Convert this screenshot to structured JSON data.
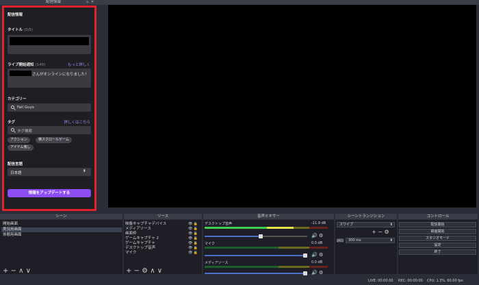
{
  "dock": {
    "title": "配信情報",
    "buttons": "▫ ✕"
  },
  "stream_info": {
    "header": "配信情報",
    "title_label": "タイトル",
    "title_count": "(0/5)",
    "notify_label": "ライブ開始通知",
    "notify_count": "(140)",
    "notify_link": "もっと詳しく",
    "notify_text": "さんがオンラインになりました！",
    "category_label": "カテゴリー",
    "category_value": "Fall Guys",
    "tag_label": "タグ",
    "tag_link": "詳しくはこちら",
    "tag_placeholder": "タグ検索",
    "tags": [
      "アクション",
      "横スクロールゲーム",
      "アイテム蒐し"
    ],
    "language_label": "配信言語",
    "language_value": "日本語",
    "language_arrow": "⬍",
    "update_button": "情報をアップデートする"
  },
  "docks": {
    "scenes": "シーン",
    "sources": "ソース",
    "mixer": "音声ミキサー",
    "transitions": "シーントランジション",
    "controls": "コントロール"
  },
  "scenes": {
    "items": [
      "開始画面",
      "実況用画面",
      "休憩用画面"
    ],
    "toolbar": "+ − ∧ ∨"
  },
  "sources": {
    "items": [
      "映像キャプチャデバイス",
      "メディアソース",
      "画面枠",
      "ゲームキャプチャ 2",
      "ゲームキャプチャ",
      "デスクトップ音声",
      "マイク"
    ],
    "item_icons": "👁 🔒",
    "toolbar": "+ − ⚙ ∧ ∨"
  },
  "mixer": {
    "channels": [
      {
        "name": "デスクトップ音声",
        "db": "-11.9 dB",
        "level": 0.72,
        "volume": 0.55
      },
      {
        "name": "マイク",
        "db": "0.0 dB",
        "level": 0.0,
        "volume": 1.0
      },
      {
        "name": "メディアソース",
        "db": "0.0 dB",
        "level": 0.0,
        "volume": 1.0
      }
    ],
    "icons": "🔊 ⚙"
  },
  "transitions": {
    "value": "スワイプ",
    "arrow": "⬍",
    "toolbar": "+ − ⚙",
    "duration_label": "期間",
    "duration_value": "300 ms"
  },
  "controls": {
    "buttons": [
      "配信開始",
      "録画開始",
      "スタジオモード",
      "設定",
      "終了"
    ]
  },
  "status": {
    "live": "LIVE: 00:00:00",
    "rec": "REC: 00:00:00",
    "cpu": "CPU: 1.3%, 60.00 fps"
  }
}
